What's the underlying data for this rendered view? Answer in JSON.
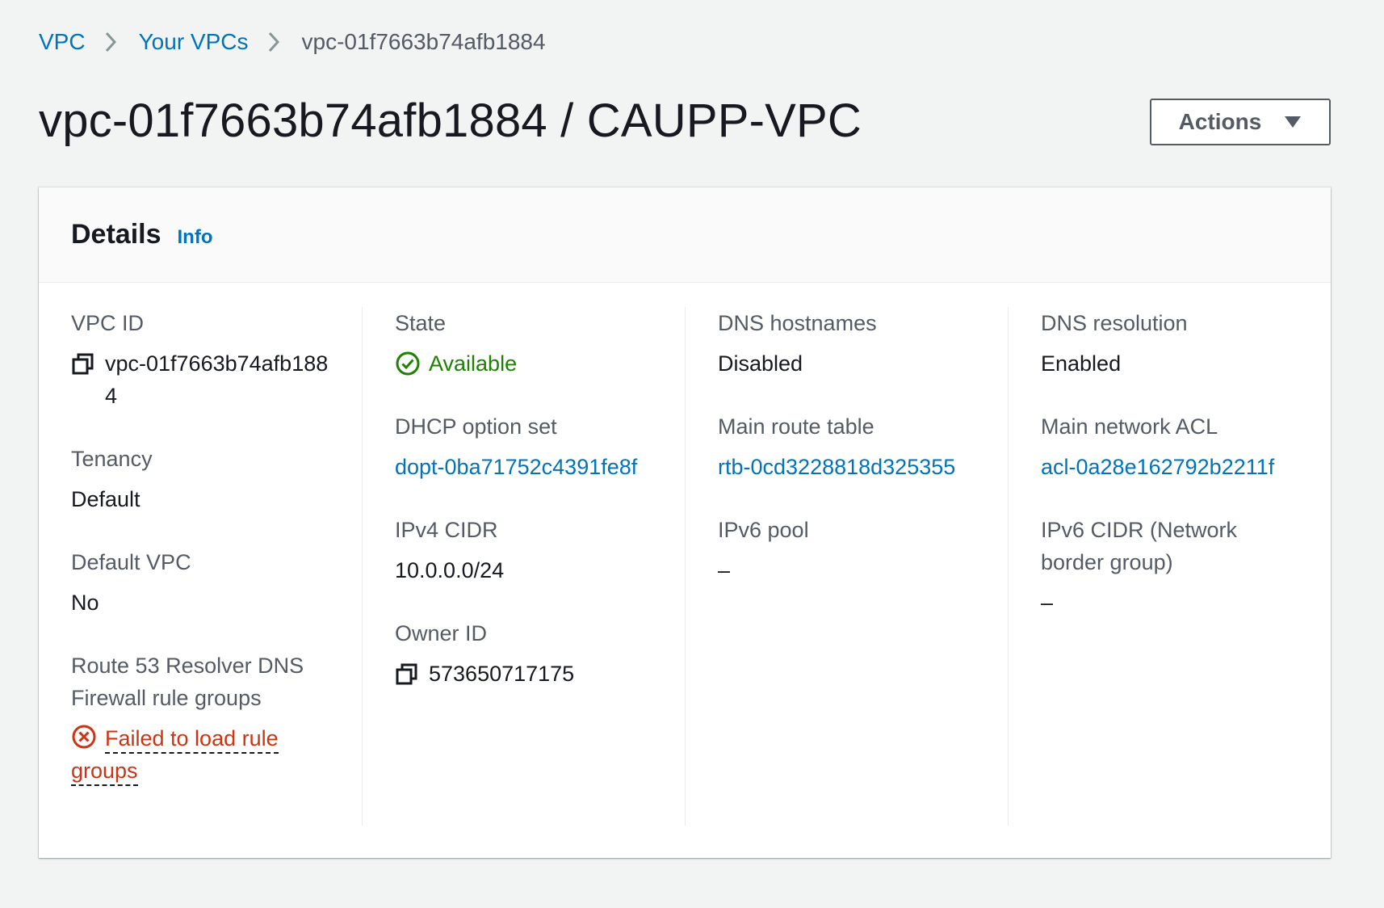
{
  "breadcrumb": {
    "items": [
      "VPC",
      "Your VPCs"
    ],
    "current": "vpc-01f7663b74afb1884"
  },
  "page": {
    "title": "vpc-01f7663b74afb1884 / CAUPP-VPC",
    "actions_label": "Actions"
  },
  "details": {
    "title": "Details",
    "info_label": "Info",
    "columns": [
      [
        {
          "label": "VPC ID",
          "value": "vpc-01f7663b74afb1884"
        },
        {
          "label": "Tenancy",
          "value": "Default"
        },
        {
          "label": "Default VPC",
          "value": "No"
        },
        {
          "label": "Route 53 Resolver DNS Firewall rule groups",
          "value": "Failed to load rule groups"
        }
      ],
      [
        {
          "label": "State",
          "value": "Available"
        },
        {
          "label": "DHCP option set",
          "value": "dopt-0ba71752c4391fe8f"
        },
        {
          "label": "IPv4 CIDR",
          "value": "10.0.0.0/24"
        },
        {
          "label": "Owner ID",
          "value": "573650717175"
        }
      ],
      [
        {
          "label": "DNS hostnames",
          "value": "Disabled"
        },
        {
          "label": "Main route table",
          "value": "rtb-0cd3228818d325355"
        },
        {
          "label": "IPv6 pool",
          "value": "–"
        }
      ],
      [
        {
          "label": "DNS resolution",
          "value": "Enabled"
        },
        {
          "label": "Main network ACL",
          "value": "acl-0a28e162792b2211f"
        },
        {
          "label": "IPv6 CIDR (Network border group)",
          "value": "–"
        }
      ]
    ]
  },
  "icons": {
    "breadcrumb_separator": "chevron-right-icon",
    "actions_caret": "caret-down-icon",
    "copy": "copy-icon",
    "status_available": "check-circle-icon",
    "status_error": "x-circle-icon"
  },
  "colors": {
    "link": "#0073bb",
    "success": "#1d8102",
    "error": "#d13212",
    "background": "#f2f3f3",
    "text": "#16191f",
    "label": "#545b64"
  }
}
